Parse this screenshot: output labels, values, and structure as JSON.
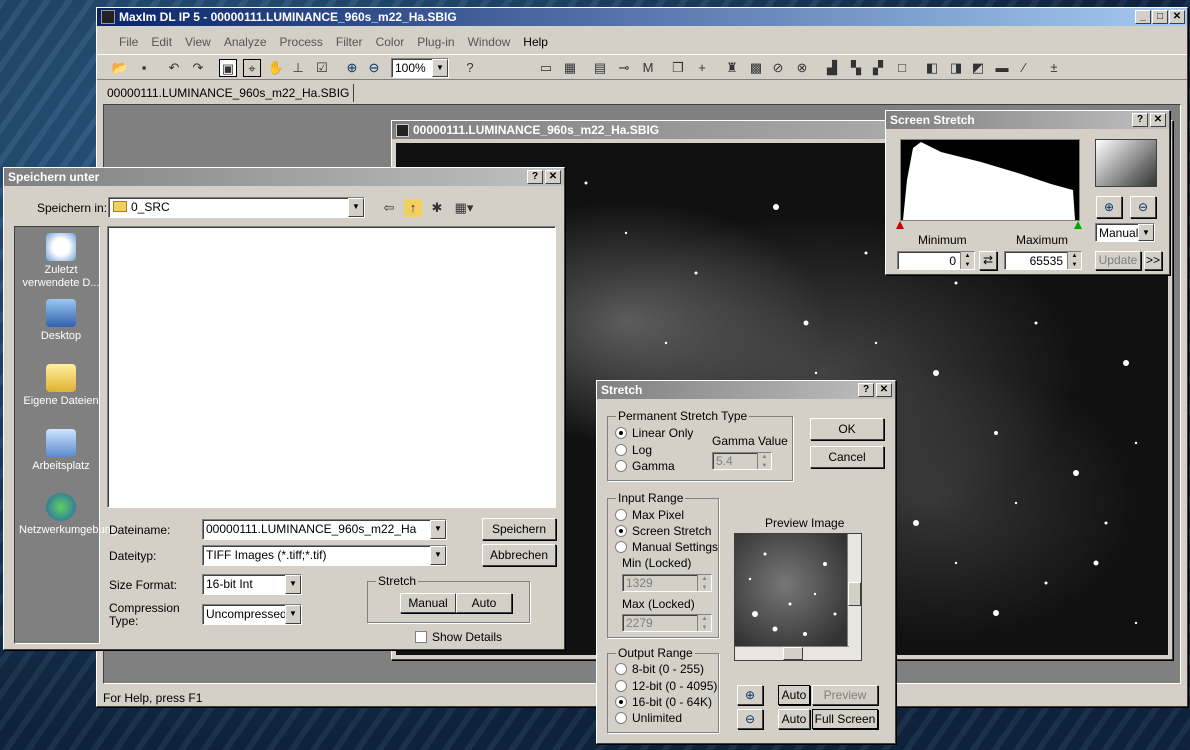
{
  "main_window": {
    "title": "MaxIm DL IP 5 - 00000111.LUMINANCE_960s_m22_Ha.SBIG",
    "menu": [
      "File",
      "Edit",
      "View",
      "Analyze",
      "Process",
      "Filter",
      "Color",
      "Plug-in",
      "Window",
      "Help"
    ],
    "zoom": "100%",
    "doc_tab": "00000111.LUMINANCE_960s_m22_Ha.SBIG",
    "status": "For Help, press F1"
  },
  "image_window": {
    "title": "00000111.LUMINANCE_960s_m22_Ha.SBIG"
  },
  "screen_stretch": {
    "title": "Screen Stretch",
    "min_label": "Minimum",
    "max_label": "Maximum",
    "min_value": "0",
    "max_value": "65535",
    "mode": "Manual",
    "update": "Update",
    "more": ">>"
  },
  "save_dialog": {
    "title": "Speichern unter",
    "save_in_label": "Speichern in:",
    "save_in_value": "0_SRC",
    "sidebar": [
      "Zuletzt verwendete D...",
      "Desktop",
      "Eigene Dateien",
      "Arbeitsplatz",
      "Netzwerkumgebung"
    ],
    "filename_label": "Dateiname:",
    "filename_value": "00000111.LUMINANCE_960s_m22_Ha",
    "filetype_label": "Dateityp:",
    "filetype_value": "TIFF Images (*.tiff;*.tif)",
    "save_button": "Speichern",
    "cancel_button": "Abbrechen",
    "size_format_label": "Size Format:",
    "size_format_value": "16-bit Int",
    "compression_label": "Compression Type:",
    "compression_value": "Uncompressed",
    "stretch_group": "Stretch",
    "manual_button": "Manual",
    "auto_button": "Auto",
    "show_details": "Show Details"
  },
  "stretch_dialog": {
    "title": "Stretch",
    "perm_group": "Permanent Stretch Type",
    "perm_options": [
      "Linear Only",
      "Log",
      "Gamma"
    ],
    "gamma_label": "Gamma Value",
    "gamma_value": "5.4",
    "ok": "OK",
    "cancel": "Cancel",
    "input_group": "Input Range",
    "input_options": [
      "Max Pixel",
      "Screen Stretch",
      "Manual Settings"
    ],
    "min_label": "Min (Locked)",
    "min_value": "1329",
    "max_label": "Max (Locked)",
    "max_value": "2279",
    "preview_label": "Preview Image",
    "output_group": "Output Range",
    "output_options": [
      "8-bit (0 - 255)",
      "12-bit (0 - 4095)",
      "16-bit (0 - 64K)",
      "Unlimited"
    ],
    "auto1": "Auto",
    "preview_button": "Preview",
    "auto2": "Auto",
    "full_screen": "Full Screen"
  }
}
